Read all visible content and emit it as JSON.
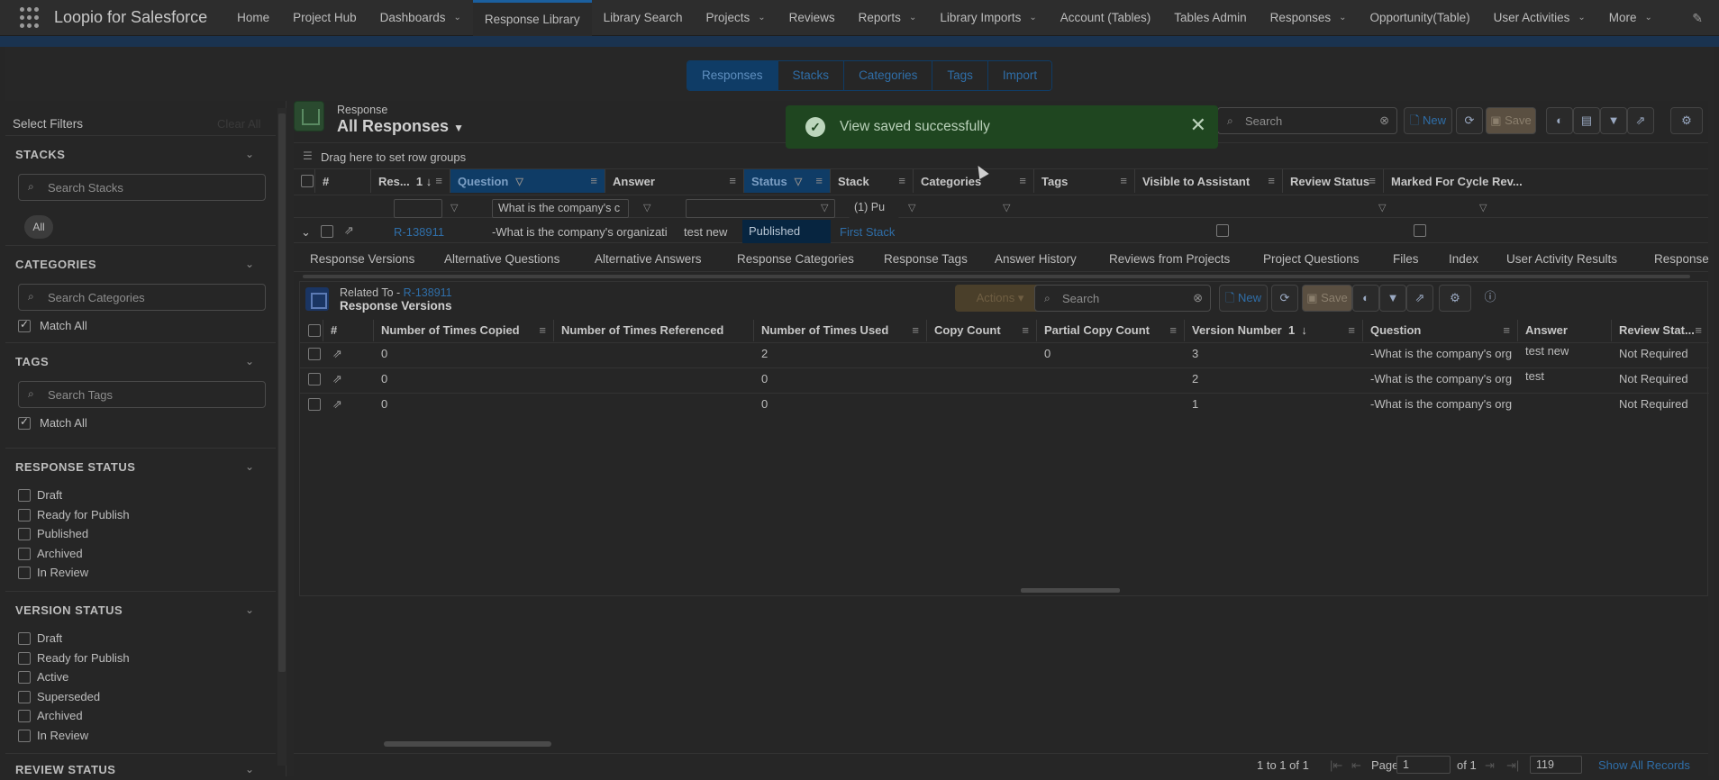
{
  "app": {
    "title": "Loopio for Salesforce"
  },
  "nav": {
    "items": [
      {
        "label": "Home",
        "chevron": false
      },
      {
        "label": "Project Hub",
        "chevron": false
      },
      {
        "label": "Dashboards",
        "chevron": true
      },
      {
        "label": "Response Library",
        "chevron": false,
        "active": true
      },
      {
        "label": "Library Search",
        "chevron": false
      },
      {
        "label": "Projects",
        "chevron": true
      },
      {
        "label": "Reviews",
        "chevron": false
      },
      {
        "label": "Reports",
        "chevron": true
      },
      {
        "label": "Library Imports",
        "chevron": true
      },
      {
        "label": "Account (Tables)",
        "chevron": false
      },
      {
        "label": "Tables Admin",
        "chevron": false
      },
      {
        "label": "Responses",
        "chevron": true
      },
      {
        "label": "Opportunity(Table)",
        "chevron": false
      },
      {
        "label": "User Activities",
        "chevron": true
      },
      {
        "label": "More",
        "chevron": true
      }
    ]
  },
  "segments": [
    "Responses",
    "Stacks",
    "Categories",
    "Tags",
    "Import"
  ],
  "filters": {
    "title": "Select Filters",
    "clear_all": "Clear All",
    "stacks": {
      "title": "STACKS",
      "search_placeholder": "Search Stacks",
      "pill": "All"
    },
    "categories": {
      "title": "CATEGORIES",
      "search_placeholder": "Search Categories",
      "match_all": "Match All"
    },
    "tags": {
      "title": "TAGS",
      "search_placeholder": "Search Tags",
      "match_all": "Match All"
    },
    "response_status": {
      "title": "RESPONSE STATUS",
      "options": [
        "Draft",
        "Ready for Publish",
        "Published",
        "Archived",
        "In Review"
      ]
    },
    "version_status": {
      "title": "VERSION STATUS",
      "options": [
        "Draft",
        "Ready for Publish",
        "Active",
        "Superseded",
        "Archived",
        "In Review"
      ]
    },
    "review_status": {
      "title": "REVIEW STATUS"
    }
  },
  "grid": {
    "object_label": "Response",
    "view_name": "All Responses",
    "search_placeholder": "Search",
    "new_label": "New",
    "save_label": "Save",
    "group_hint": "Drag here to set row groups",
    "columns": [
      "#",
      "Res...",
      "Question",
      "Answer",
      "Status",
      "Stack",
      "Categories",
      "Tags",
      "Visible to Assistant",
      "Review Status",
      "Marked For Cycle Rev..."
    ],
    "sort_index": "1",
    "filter_values": {
      "question": "What is the company's c",
      "status": "(1) Pu"
    },
    "row": {
      "id": "R-138911",
      "question": "-What is the company's organizati",
      "answer": "test new",
      "status": "Published",
      "stack": "First Stack"
    }
  },
  "toast": {
    "message": "View saved successfully"
  },
  "subtabs": [
    "Response Versions",
    "Alternative Questions",
    "Alternative Answers",
    "Response Categories",
    "Response Tags",
    "Answer History",
    "Reviews from Projects",
    "Project Questions",
    "Files",
    "Index",
    "User Activity Results",
    "Response"
  ],
  "related": {
    "prefix": "Related To - ",
    "record": "R-138911",
    "title": "Response Versions",
    "actions_label": "Actions",
    "search_placeholder": "Search",
    "new_label": "New",
    "save_label": "Save",
    "columns": [
      "#",
      "Number of Times Copied",
      "Number of Times Referenced",
      "Number of Times Used",
      "Copy Count",
      "Partial Copy Count",
      "Version Number",
      "Question",
      "Answer",
      "Review Stat..."
    ],
    "sort_index": "1",
    "rows": [
      {
        "copied": "0",
        "referenced": "",
        "used": "2",
        "copy_count": "",
        "partial": "0",
        "version": "3",
        "question": "-What is the company's org",
        "answer": "test new",
        "review": "Not Required"
      },
      {
        "copied": "0",
        "referenced": "",
        "used": "0",
        "copy_count": "",
        "partial": "",
        "version": "2",
        "question": "-What is the company's org",
        "answer": "test",
        "review": "Not Required"
      },
      {
        "copied": "0",
        "referenced": "",
        "used": "0",
        "copy_count": "",
        "partial": "",
        "version": "1",
        "question": "-What is the company's org",
        "answer": "",
        "review": "Not Required"
      }
    ]
  },
  "pager": {
    "range": "1 to 1 of 1",
    "page_label": "Page",
    "page_value": "1",
    "of_label": "of 1",
    "page_size": "119",
    "show_all": "Show All Records"
  }
}
